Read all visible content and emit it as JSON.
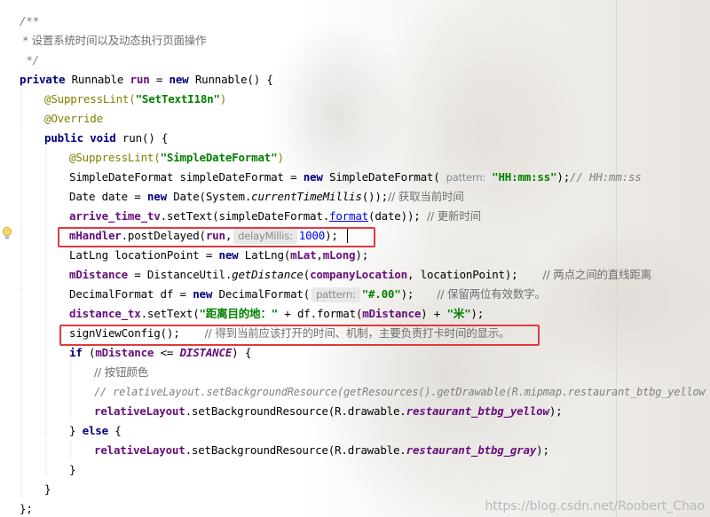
{
  "editor": {
    "watermark": "https://blog.csdn.net/Roobert_Chao",
    "code": {
      "l1": "/**",
      "l2": " * 设置系统时间以及动态执行页面操作",
      "l3": " */",
      "l4_kw1": "private",
      "l4_t1": " Runnable ",
      "l4_fld": "run",
      "l4_t2": " = ",
      "l4_kw2": "new",
      "l4_t3": " Runnable() {",
      "l5_ann": "@SuppressLint(",
      "l5_str": "\"SetTextI18n\"",
      "l5_end": ")",
      "l6_ann": "@Override",
      "l7_kw1": "public",
      "l7_sp": " ",
      "l7_kw2": "void",
      "l7_t": " run() {",
      "l8_ann": "@SuppressLint(",
      "l8_str": "\"SimpleDateFormat\"",
      "l8_end": ")",
      "l9_t1": "SimpleDateFormat simpleDateFormat = ",
      "l9_kw": "new",
      "l9_t2": " SimpleDateFormat(",
      "l9_hint": "pattern:",
      "l9_str": "\"HH:mm:ss\"",
      "l9_t3": ");",
      "l9_cmt": "// HH:mm:ss",
      "l10_t1": "Date date = ",
      "l10_kw": "new",
      "l10_t2": " Date(System.",
      "l10_it": "currentTimeMillis",
      "l10_t3": "());",
      "l10_cmt": "// 获取当前时间",
      "l11_fld": "arrive_time_tv",
      "l11_t1": ".setText(simpleDateFormat.",
      "l11_link": "format",
      "l11_t2": "(date)); ",
      "l11_cmt": "// 更新时间",
      "l12_fld": "mHandler",
      "l12_t1": ".postDelayed(",
      "l12_fld2": "run",
      "l12_t2": ",",
      "l12_hint": "delayMillis:",
      "l12_num": "1000",
      "l12_t3": ");",
      "l13_t1": "LatLng locationPoint = ",
      "l13_kw": "new",
      "l13_t2": " LatLng(",
      "l13_f1": "mLat",
      "l13_c": ",",
      "l13_f2": "mLong",
      "l13_t3": ");",
      "l14_fld": "mDistance",
      "l14_t1": " = DistanceUtil.",
      "l14_it": "getDistance",
      "l14_t2": "(",
      "l14_f2": "companyLocation",
      "l14_t3": ", locationPoint);",
      "l14_cmt": "// 两点之间的直线距离",
      "l15_t1": "DecimalFormat df = ",
      "l15_kw": "new",
      "l15_t2": " DecimalFormat(",
      "l15_hint": "pattern:",
      "l15_str": "\"#.00\"",
      "l15_t3": ");",
      "l15_cmt": "// 保留两位有效数字。",
      "l16_fld": "distance_tx",
      "l16_t1": ".setText(",
      "l16_str": "\"距离目的地：\"",
      "l16_t2": " + df.format(",
      "l16_f2": "mDistance",
      "l16_t3": ") + ",
      "l16_str2": "\"米\"",
      "l16_t4": ");",
      "l17_t1": "signViewConfig();",
      "l17_cmt": "// 得到当前应该打开的时间、机制，主要负责打卡时间的显示。",
      "l18_kw": "if",
      "l18_t1": " (",
      "l18_fld": "mDistance",
      "l18_t2": " <= ",
      "l18_sf": "DISTANCE",
      "l18_t3": ") {",
      "l19_cmt": "// 按钮颜色",
      "l20_cmt": "// relativeLayout.setBackgroundResource(getResources().getDrawable(R.mipmap.restaurant_btbg_yellow",
      "l21_fld": "relativeLayout",
      "l21_t1": ".setBackgroundResource(R.drawable.",
      "l21_sf": "restaurant_btbg_yellow",
      "l21_t2": ");",
      "l22_t1": "} ",
      "l22_kw": "else",
      "l22_t2": " {",
      "l23_fld": "relativeLayout",
      "l23_t1": ".setBackgroundResource(R.drawable.",
      "l23_sf": "restaurant_btbg_gray",
      "l23_t2": ");",
      "l24": "}",
      "l25": "}",
      "l26": "};"
    }
  }
}
